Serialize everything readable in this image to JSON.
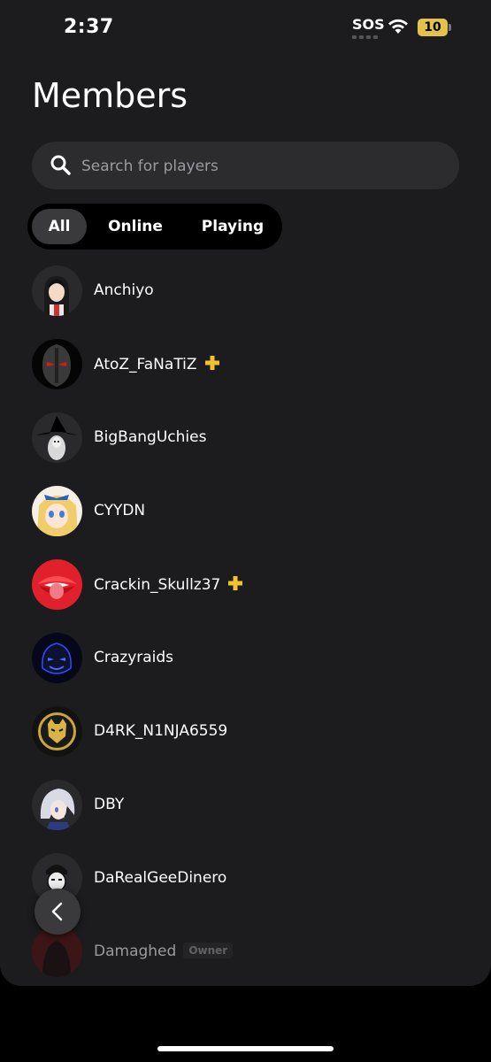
{
  "status_bar": {
    "time": "2:37",
    "sos": "SOS",
    "battery": "10"
  },
  "page": {
    "title": "Members"
  },
  "search": {
    "placeholder": "Search for players"
  },
  "filters": [
    {
      "label": "All",
      "active": true
    },
    {
      "label": "Online",
      "active": false
    },
    {
      "label": "Playing",
      "active": false
    }
  ],
  "members": [
    {
      "name": "Anchiyo",
      "plus": false
    },
    {
      "name": "AtoZ_FaNaTiZ",
      "plus": true
    },
    {
      "name": "BigBangUchies",
      "plus": false
    },
    {
      "name": "CYYDN",
      "plus": false
    },
    {
      "name": "Crackin_Skullz37",
      "plus": true
    },
    {
      "name": "Crazyraids",
      "plus": false
    },
    {
      "name": "D4RK_N1NJA6559",
      "plus": false
    },
    {
      "name": "DBY",
      "plus": false
    },
    {
      "name": "DaRealGeeDinero",
      "plus": false
    },
    {
      "name": "Damaghed",
      "plus": false,
      "badge": "Owner"
    }
  ],
  "colors": {
    "plus_gold": "#f2c230",
    "background": "#1c1c1e",
    "active_tab": "#3a3a3c"
  }
}
